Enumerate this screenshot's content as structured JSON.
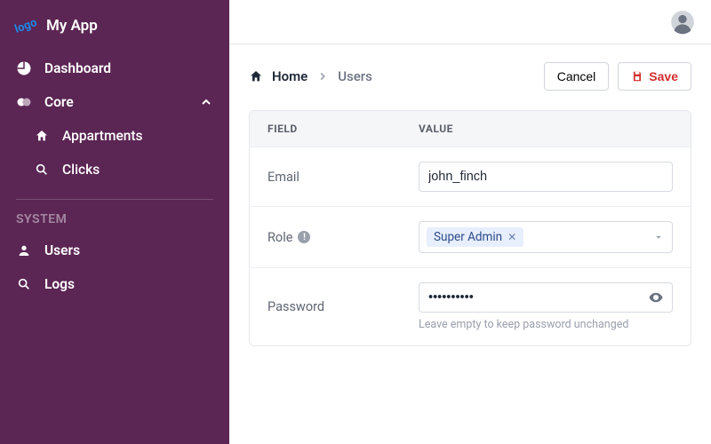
{
  "brand": {
    "name": "My App",
    "logo_text": "logo"
  },
  "nav": {
    "items": [
      {
        "label": "Dashboard"
      },
      {
        "label": "Core"
      }
    ],
    "core_children": [
      {
        "label": "Appartments"
      },
      {
        "label": "Clicks"
      }
    ],
    "system_label": "SYSTEM",
    "system_items": [
      {
        "label": "Users"
      },
      {
        "label": "Logs"
      }
    ]
  },
  "breadcrumb": {
    "home": "Home",
    "current": "Users"
  },
  "actions": {
    "cancel": "Cancel",
    "save": "Save"
  },
  "form": {
    "header_field": "FIELD",
    "header_value": "VALUE",
    "email": {
      "label": "Email",
      "value": "john_finch"
    },
    "role": {
      "label": "Role",
      "selected": "Super Admin"
    },
    "password": {
      "label": "Password",
      "value": "••••••••••",
      "hint": "Leave empty to keep password unchanged"
    }
  }
}
